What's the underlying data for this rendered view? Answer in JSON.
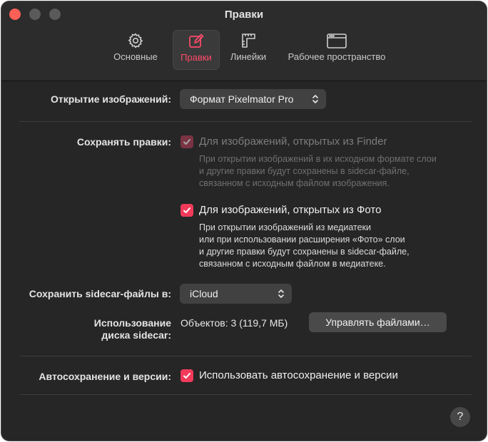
{
  "window": {
    "title": "Правки"
  },
  "toolbar": {
    "tabs": [
      {
        "label": "Основные",
        "icon": "gear-icon"
      },
      {
        "label": "Правки",
        "icon": "edit-icon",
        "active": true
      },
      {
        "label": "Линейки",
        "icon": "ruler-icon"
      },
      {
        "label": "Рабочее пространство",
        "icon": "window-icon"
      }
    ]
  },
  "open_images": {
    "label": "Открытие изображений:",
    "value": "Формат Pixelmator Pro"
  },
  "save_edits": {
    "label": "Сохранять правки:",
    "finder": {
      "label": "Для изображений, открытых из Finder",
      "checked": true,
      "enabled": false,
      "description": [
        "При открытии изображений в их исходном формате слои",
        "и другие правки будут сохранены в sidecar-файле,",
        "связанном с исходным файлом изображения."
      ]
    },
    "photos": {
      "label": "Для изображений, открытых из Фото",
      "checked": true,
      "enabled": true,
      "description": [
        "При открытии изображений из медиатеки",
        "или при использовании расширения «Фото» слои",
        "и другие правки будут сохранены в sidecar-файле,",
        "связанном с исходным файлом в медиатеке."
      ]
    }
  },
  "sidecar_location": {
    "label": "Сохранить sidecar-файлы в:",
    "value": "iCloud"
  },
  "sidecar_usage": {
    "label_line1": "Использование",
    "label_line2": "диска sidecar:",
    "value": "Объектов: 3 (119,7 МБ)",
    "manage_label": "Управлять файлами…"
  },
  "autosave": {
    "label": "Автосохранение и версии:",
    "checkbox_label": "Использовать автосохранение и версии",
    "checked": true
  },
  "help": {
    "label": "?"
  },
  "colors": {
    "accent": "#f23a5a",
    "close": "#fe5f57",
    "window_bg": "#262626"
  }
}
